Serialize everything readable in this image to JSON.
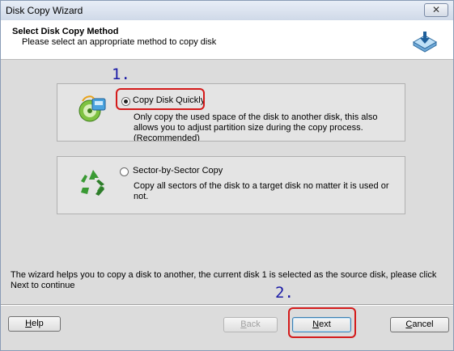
{
  "window": {
    "title": "Disk Copy Wizard",
    "close_glyph": "✕"
  },
  "header": {
    "title": "Select Disk Copy Method",
    "subtitle": "Please select an appropriate method to copy disk",
    "icon": "disk-copy-icon"
  },
  "options": [
    {
      "label": "Copy Disk Quickly",
      "selected": true,
      "icon": "disk-copy-quick-icon",
      "description": "Only copy the used space of the disk to another disk, this also allows you to adjust partition size during the copy process.(Recommended)"
    },
    {
      "label": "Sector-by-Sector Copy",
      "selected": false,
      "icon": "recycle-icon",
      "description": "Copy all sectors of the disk to a target disk no matter it is used or not."
    }
  ],
  "annotations": {
    "step1": "1.",
    "step2": "2.",
    "highlight_color": "#d41a1a",
    "step_color": "#1a1aa6"
  },
  "info_text": "The wizard helps you to copy a disk to another, the current disk 1 is selected as the source disk, please click Next to continue",
  "buttons": {
    "help": {
      "prefix": "",
      "key": "H",
      "rest": "elp"
    },
    "back": {
      "prefix": "",
      "key": "B",
      "rest": "ack",
      "disabled": true
    },
    "next": {
      "prefix": "",
      "key": "N",
      "rest": "ext"
    },
    "cancel": {
      "prefix": "",
      "key": "C",
      "rest": "ancel"
    }
  }
}
